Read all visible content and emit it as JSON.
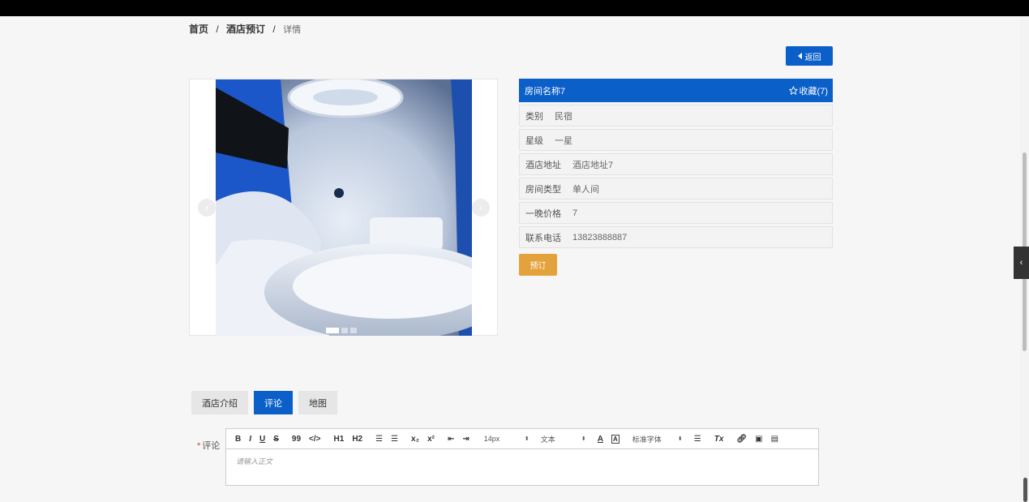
{
  "breadcrumb": {
    "home": "首页",
    "section": "酒店预订",
    "current": "详情",
    "separator": "/"
  },
  "back_button": {
    "label": "返回"
  },
  "gallery": {
    "prev": "‹",
    "next": "›",
    "slide_count": 3,
    "active_slide": 1
  },
  "room": {
    "title": "房间名称7",
    "favorite_label": "收藏(7)",
    "fields": [
      {
        "key": "类别",
        "value": "民宿"
      },
      {
        "key": "星级",
        "value": "一星"
      },
      {
        "key": "酒店地址",
        "value": "酒店地址7"
      },
      {
        "key": "房间类型",
        "value": "单人间"
      },
      {
        "key": "一晚价格",
        "value": "7"
      },
      {
        "key": "联系电话",
        "value": "13823888887"
      }
    ],
    "book_label": "预订"
  },
  "tabs": [
    {
      "label": "酒店介绍",
      "active": false
    },
    {
      "label": "评论",
      "active": true
    },
    {
      "label": "地图",
      "active": false
    }
  ],
  "comment": {
    "required_mark": "*",
    "label": "评论",
    "placeholder": "请输入正文",
    "toolbar": {
      "bold": "B",
      "italic": "I",
      "underline": "U",
      "strike": "S",
      "quote": "99",
      "code": "</>",
      "h1": "H1",
      "h2": "H2",
      "sub": "x₂",
      "sup": "x²",
      "size": "14px",
      "format": "文本",
      "font": "标准字体",
      "color": "A",
      "bg": "A",
      "clear": "Tx"
    }
  },
  "side_toggle": "‹",
  "colors": {
    "primary": "#0b5fc9",
    "book": "#e3a23b"
  }
}
